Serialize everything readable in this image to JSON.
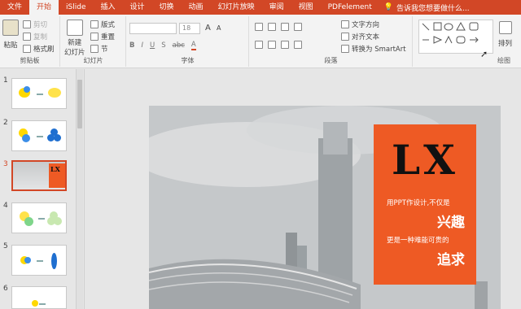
{
  "menu": {
    "items": [
      "文件",
      "开始",
      "iSlide",
      "插入",
      "设计",
      "切换",
      "动画",
      "幻灯片放映",
      "审阅",
      "视图",
      "PDFelement"
    ],
    "active_index": 1,
    "tell_me": "告诉我您想要做什么..."
  },
  "ribbon": {
    "clipboard": {
      "paste": "粘贴",
      "cut": "剪切",
      "copy": "复制",
      "format_painter": "格式刷",
      "label": "剪贴板"
    },
    "slides": {
      "new_slide": "新建",
      "new_slide2": "幻灯片",
      "layout": "版式",
      "reset": "重置",
      "section": "节",
      "label": "幻灯片"
    },
    "font": {
      "size": "18",
      "grow": "A",
      "shrink": "A",
      "label": "字体"
    },
    "paragraph": {
      "text_direction": "文字方向",
      "align_text": "对齐文本",
      "convert_smartart": "转换为 SmartArt",
      "label": "段落"
    },
    "drawing": {
      "arrange": "排列",
      "label": "绘图"
    }
  },
  "thumbnails": [
    {
      "num": "1"
    },
    {
      "num": "2"
    },
    {
      "num": "3"
    },
    {
      "num": "4"
    },
    {
      "num": "5"
    },
    {
      "num": "6"
    }
  ],
  "slide": {
    "logo": "LX",
    "line1": "用PPT作设计,不仅是",
    "word1": "兴趣",
    "line2": "更是一种难能可贵的",
    "word2": "追求"
  },
  "colors": {
    "accent": "#d24726",
    "card": "#ee5a24"
  }
}
